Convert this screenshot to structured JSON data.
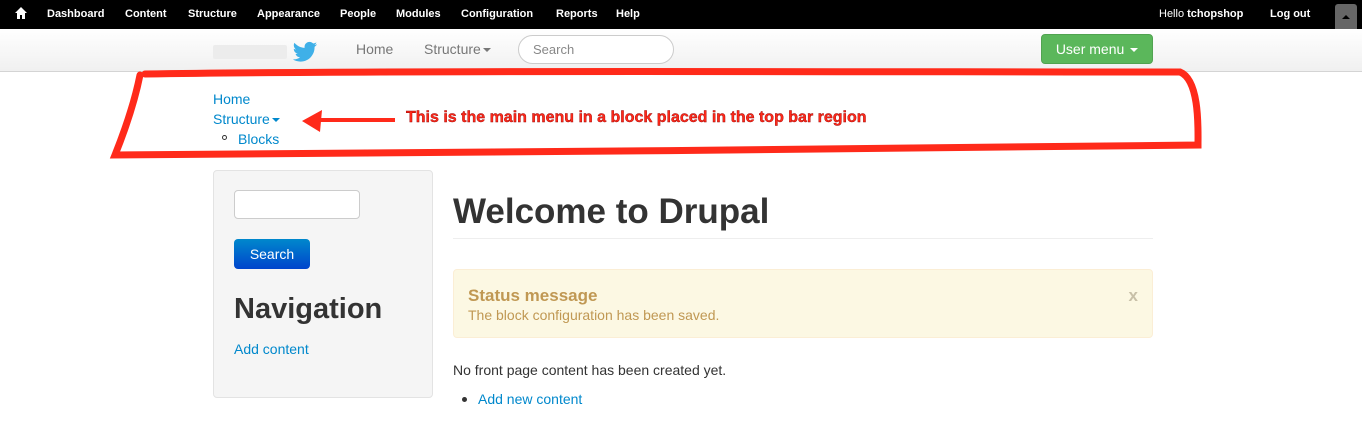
{
  "toolbar": {
    "items": [
      "Dashboard",
      "Content",
      "Structure",
      "Appearance",
      "People",
      "Modules",
      "Configuration",
      "Reports",
      "Help"
    ],
    "hello": "Hello",
    "user": "tchopshop",
    "logout": "Log out"
  },
  "navbar": {
    "home": "Home",
    "structure": "Structure",
    "search_placeholder": "Search",
    "user_menu": "User menu"
  },
  "topbar_menu": {
    "home": "Home",
    "structure": "Structure",
    "blocks": "Blocks"
  },
  "annotation": "This is the main menu in a block placed in the top bar region",
  "sidebar": {
    "search_button": "Search",
    "nav_title": "Navigation",
    "add_content": "Add content"
  },
  "main": {
    "title": "Welcome to Drupal",
    "status_title": "Status message",
    "status_text": "The block configuration has been saved.",
    "close": "x",
    "no_content": "No front page content has been created yet.",
    "add_new": "Add new content"
  }
}
